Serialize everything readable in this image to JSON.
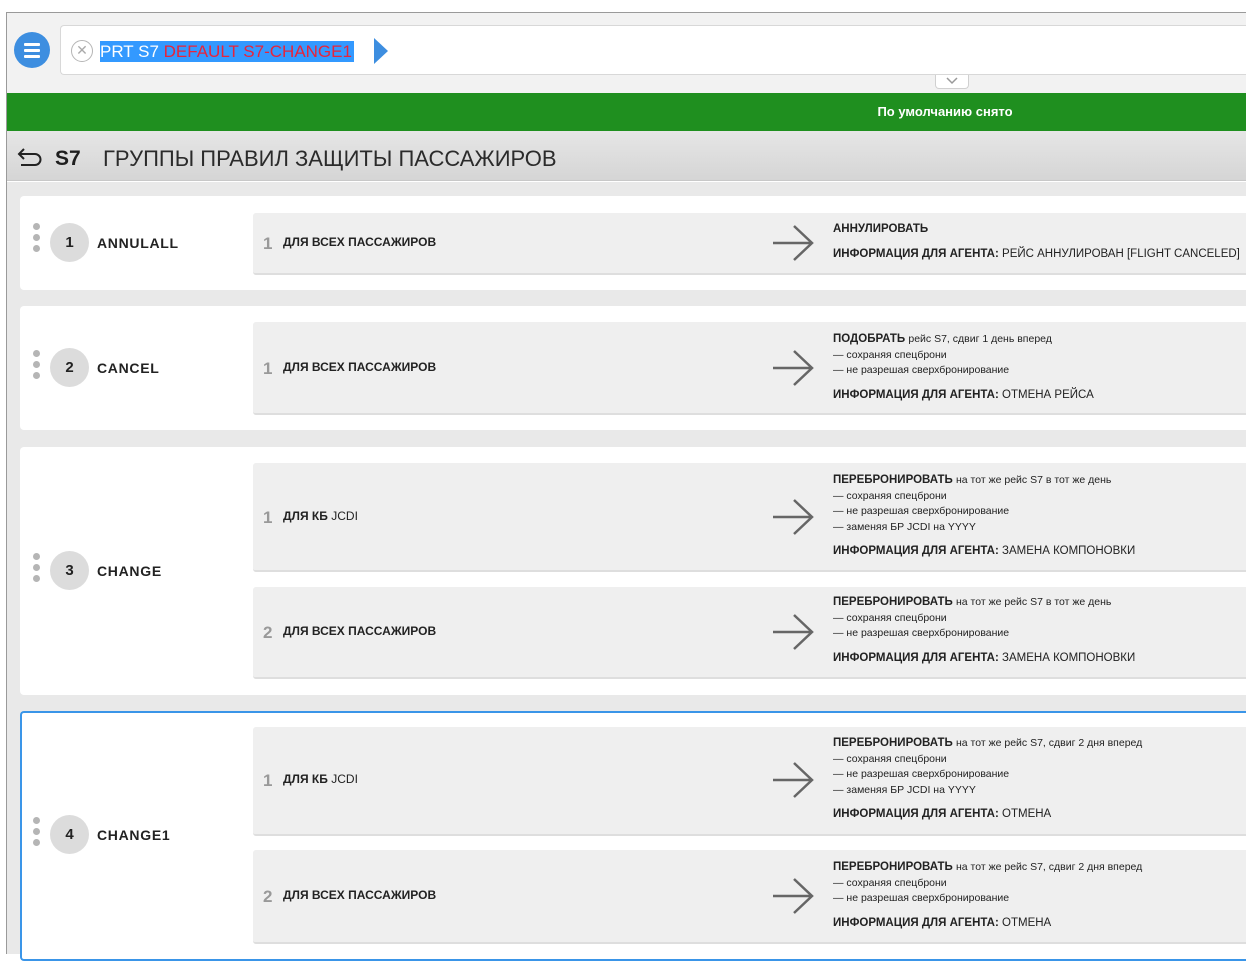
{
  "command": {
    "part1": "PRT S7",
    "part2": "DEFAULT S7-CHANGE1"
  },
  "status": "По умолчанию снято",
  "header": {
    "code": "S7",
    "title": "ГРУППЫ ПРАВИЛ ЗАЩИТЫ ПАССАЖИРОВ"
  },
  "groups": [
    {
      "num": "1",
      "name": "ANNULALL",
      "rules": [
        {
          "num": "1",
          "cond": "ДЛЯ ВСЕХ ПАССАЖИРОВ",
          "action": "АННУЛИРОВАТЬ",
          "action_rest": "",
          "lines": [],
          "info_label": "ИНФОРМАЦИЯ ДЛЯ АГЕНТА:",
          "info": "РЕЙС АННУЛИРОВАН [FLIGHT CANCELED]"
        }
      ]
    },
    {
      "num": "2",
      "name": "CANCEL",
      "rules": [
        {
          "num": "1",
          "cond": "ДЛЯ ВСЕХ ПАССАЖИРОВ",
          "action": "ПОДОБРАТЬ",
          "action_rest": "рейс S7, сдвиг 1 день вперед",
          "lines": [
            "— сохраняя спецброни",
            "— не разрешая сверхбронирование"
          ],
          "info_label": "ИНФОРМАЦИЯ ДЛЯ АГЕНТА:",
          "info": "ОТМЕНА РЕЙСА"
        }
      ]
    },
    {
      "num": "3",
      "name": "CHANGE",
      "rules": [
        {
          "num": "1",
          "cond": "ДЛЯ КБ",
          "cond_light": "JCDI",
          "action": "ПЕРЕБРОНИРОВАТЬ",
          "action_rest": "на тот же рейс S7 в тот же день",
          "lines": [
            "— сохраняя спецброни",
            "— не разрешая сверхбронирование",
            "— заменяя БР JCDI на YYYY"
          ],
          "info_label": "ИНФОРМАЦИЯ ДЛЯ АГЕНТА:",
          "info": "ЗАМЕНА КОМПОНОВКИ"
        },
        {
          "num": "2",
          "cond": "ДЛЯ ВСЕХ ПАССАЖИРОВ",
          "action": "ПЕРЕБРОНИРОВАТЬ",
          "action_rest": "на тот же рейс S7 в тот же день",
          "lines": [
            "— сохраняя спецброни",
            "— не разрешая сверхбронирование"
          ],
          "info_label": "ИНФОРМАЦИЯ ДЛЯ АГЕНТА:",
          "info": "ЗАМЕНА КОМПОНОВКИ"
        }
      ]
    },
    {
      "num": "4",
      "name": "CHANGE1",
      "rules": [
        {
          "num": "1",
          "cond": "ДЛЯ КБ",
          "cond_light": "JCDI",
          "action": "ПЕРЕБРОНИРОВАТЬ",
          "action_rest": "на тот же рейс S7, сдвиг 2 дня вперед",
          "lines": [
            "— сохраняя спецброни",
            "— не разрешая сверхбронирование",
            "— заменяя БР JCDI на YYYY"
          ],
          "info_label": "ИНФОРМАЦИЯ ДЛЯ АГЕНТА:",
          "info": "ОТМЕНА"
        },
        {
          "num": "2",
          "cond": "ДЛЯ ВСЕХ ПАССАЖИРОВ",
          "action": "ПЕРЕБРОНИРОВАТЬ",
          "action_rest": "на тот же рейс S7, сдвиг 2 дня вперед",
          "lines": [
            "— сохраняя спецброни",
            "— не разрешая сверхбронирование"
          ],
          "info_label": "ИНФОРМАЦИЯ ДЛЯ АГЕНТА:",
          "info": "ОТМЕНА"
        }
      ]
    }
  ],
  "icons": {
    "menu": "menu-icon",
    "clear": "clear-icon",
    "run": "play-arrow-icon",
    "expand": "chevron-down-icon",
    "back": "back-arrow-icon",
    "rule_arrow": "arrow-right-icon",
    "grip": "drag-handle-icon"
  },
  "colors": {
    "accent": "#3d8ee0",
    "status_bg": "#1f8f1f",
    "selection": "#3399ff",
    "command_red": "#e8243a",
    "active_border": "#3a95e8"
  }
}
